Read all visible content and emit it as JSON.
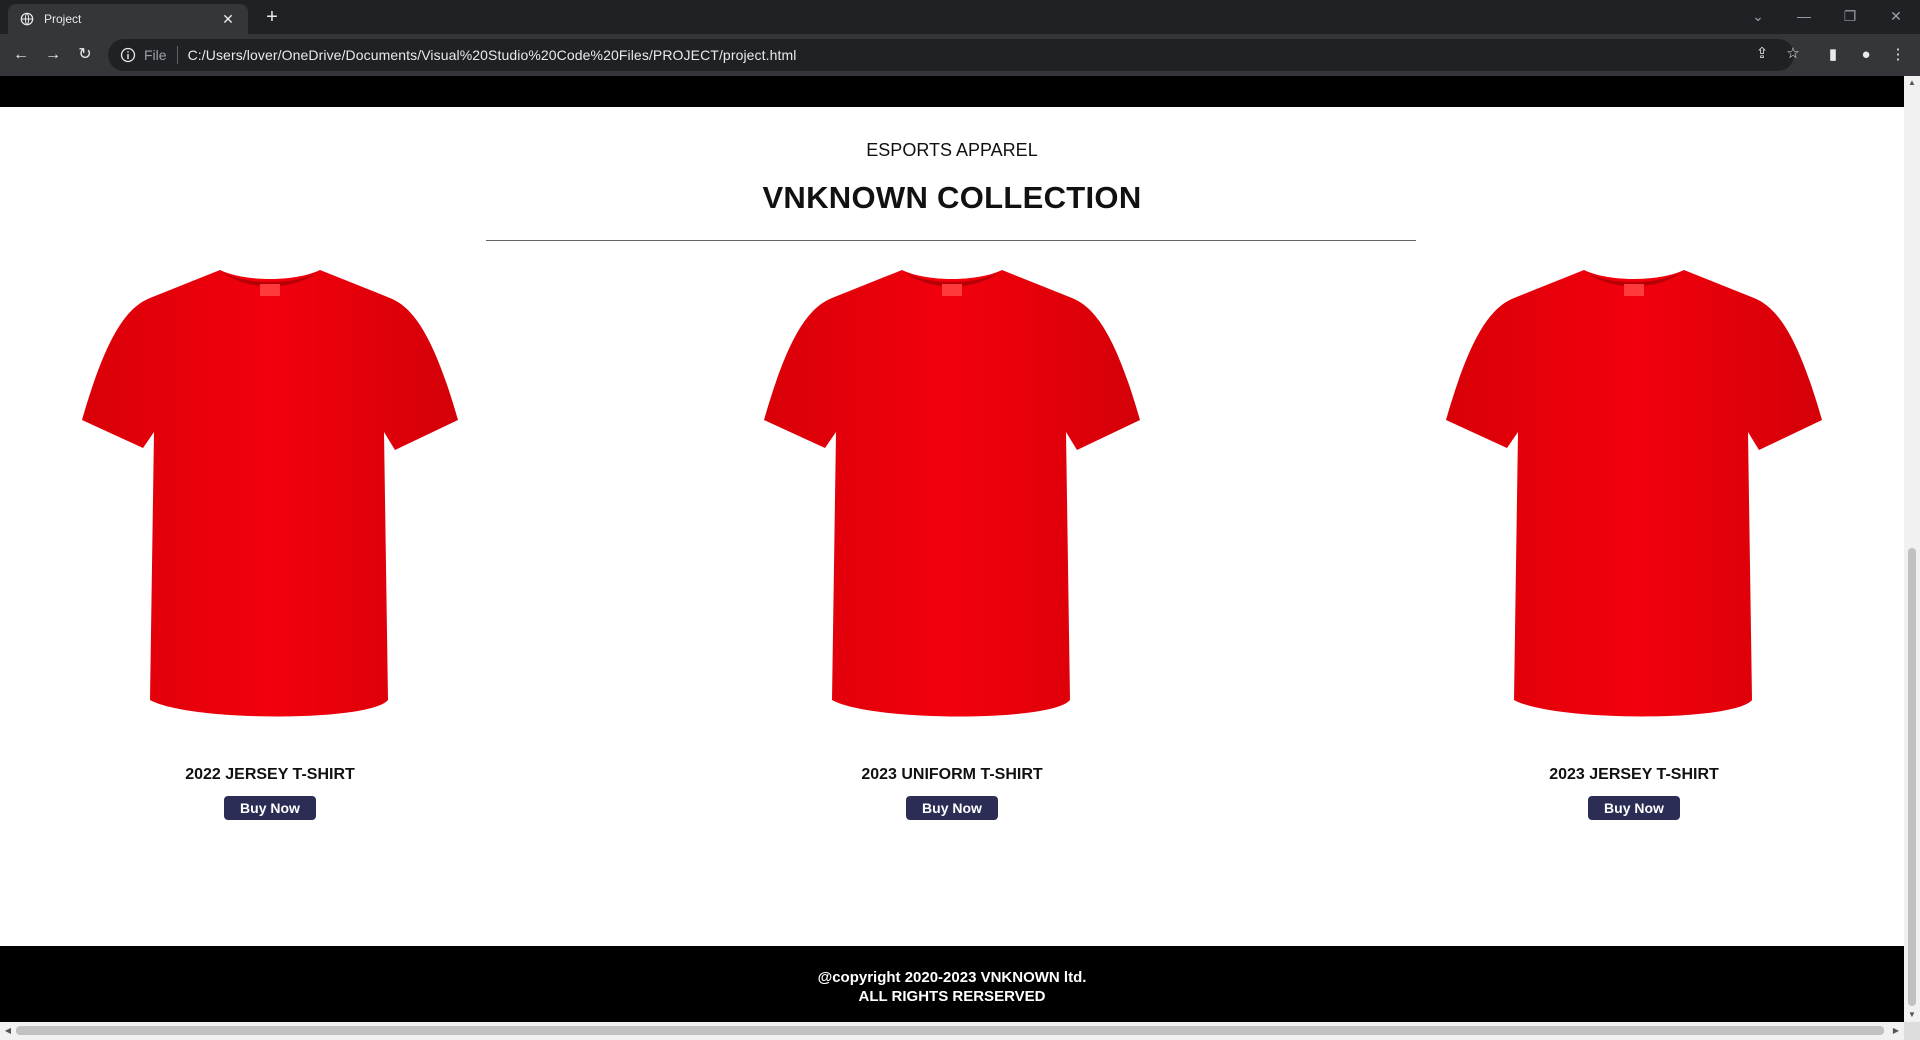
{
  "browser": {
    "tab_title": "Project",
    "close_glyph": "✕",
    "new_tab_glyph": "+",
    "scheme_label": "File",
    "url": "C:/Users/lover/OneDrive/Documents/Visual%20Studio%20Code%20Files/PROJECT/project.html",
    "icons": [
      "globe-icon",
      "back-icon",
      "forward-icon",
      "reload-icon",
      "info-icon",
      "share-icon",
      "star-icon",
      "side-panel-icon",
      "profile-icon",
      "kebab-menu-icon",
      "minimize-icon",
      "restore-icon",
      "close-window-icon",
      "tab-search-icon"
    ]
  },
  "page": {
    "kicker": "ESPORTS APPAREL",
    "heading": "VNKNOWN COLLECTION",
    "products": [
      {
        "name": "2022 JERSEY T-SHIRT",
        "button": "Buy Now"
      },
      {
        "name": "2023 UNIFORM T-SHIRT",
        "button": "Buy Now"
      },
      {
        "name": "2023 JERSEY T-SHIRT",
        "button": "Buy Now"
      }
    ],
    "footer": {
      "line1": "@copyright 2020-2023 VNKNOWN ltd.",
      "line2": "ALL RIGHTS RERSERVED"
    }
  },
  "colors": {
    "chrome_dark": "#202124",
    "chrome_mid": "#35363a",
    "shirt_red": "#e8000a",
    "button_bg": "#2b2d55",
    "footer_bg": "#000000"
  }
}
